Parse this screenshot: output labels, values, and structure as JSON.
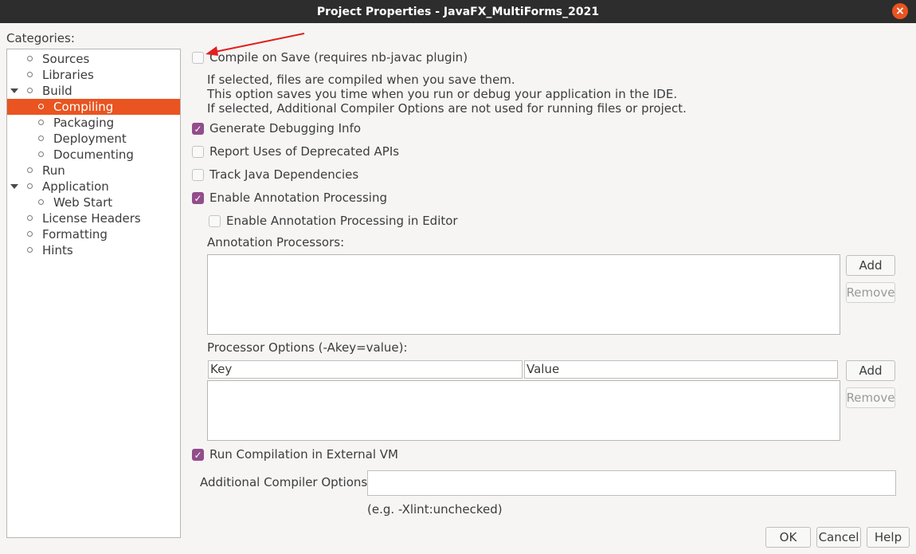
{
  "window": {
    "title": "Project Properties - JavaFX_MultiForms_2021",
    "close_glyph": "×"
  },
  "categories": {
    "label": "Categories:",
    "items": [
      {
        "label": "Sources"
      },
      {
        "label": "Libraries"
      },
      {
        "label": "Build",
        "expanded": true
      },
      {
        "label": "Compiling",
        "selected": true
      },
      {
        "label": "Packaging"
      },
      {
        "label": "Deployment"
      },
      {
        "label": "Documenting"
      },
      {
        "label": "Run"
      },
      {
        "label": "Application",
        "expanded": true
      },
      {
        "label": "Web Start"
      },
      {
        "label": "License Headers"
      },
      {
        "label": "Formatting"
      },
      {
        "label": "Hints"
      }
    ]
  },
  "options": {
    "compile_on_save": {
      "label": "Compile on Save (requires nb-javac plugin)",
      "checked": false
    },
    "compile_on_save_desc": [
      "If selected, files are compiled when you save them.",
      "This option saves you time when you run or debug your application in the IDE.",
      "If selected, Additional Compiler Options are not used for running files or project."
    ],
    "generate_debug": {
      "label": "Generate Debugging Info",
      "checked": true
    },
    "report_deprecated": {
      "label": "Report Uses of Deprecated APIs",
      "checked": false
    },
    "track_deps": {
      "label": "Track Java Dependencies",
      "checked": false
    },
    "annotation_processing": {
      "label": "Enable Annotation Processing",
      "checked": true
    },
    "annotation_in_editor": {
      "label": "Enable Annotation Processing in Editor",
      "checked": false
    },
    "run_external_vm": {
      "label": "Run Compilation in External VM",
      "checked": true
    },
    "check_glyph": "✓"
  },
  "annotation_processors": {
    "label": "Annotation Processors:",
    "add_label": "Add",
    "remove_label": "Remove"
  },
  "processor_options": {
    "label": "Processor Options (-Akey=value):",
    "col_key": "Key",
    "col_value": "Value",
    "add_label": "Add",
    "remove_label": "Remove"
  },
  "additional_options": {
    "label": "Additional Compiler Options:",
    "value": "",
    "hint": "(e.g. -Xlint:unchecked)"
  },
  "footer": {
    "ok_label": "OK",
    "cancel_label": "Cancel",
    "help_label": "Help"
  },
  "colors": {
    "accent": "#e95420",
    "checkbox_checked": "#924d8b",
    "annotation_arrow": "#e02020"
  }
}
